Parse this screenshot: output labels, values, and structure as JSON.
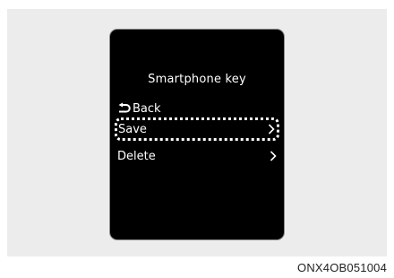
{
  "screen": {
    "title": "Smartphone key",
    "menu": [
      {
        "label": "Back",
        "icon": "back-arrow-icon"
      },
      {
        "label": "Save",
        "icon": "chevron-right-icon",
        "selected": true
      },
      {
        "label": "Delete",
        "icon": "chevron-right-icon"
      }
    ]
  },
  "caption": "ONX4OB051004",
  "colors": {
    "panel_background": "#ececed",
    "screen_background": "#000000",
    "text": "#ffffff"
  }
}
